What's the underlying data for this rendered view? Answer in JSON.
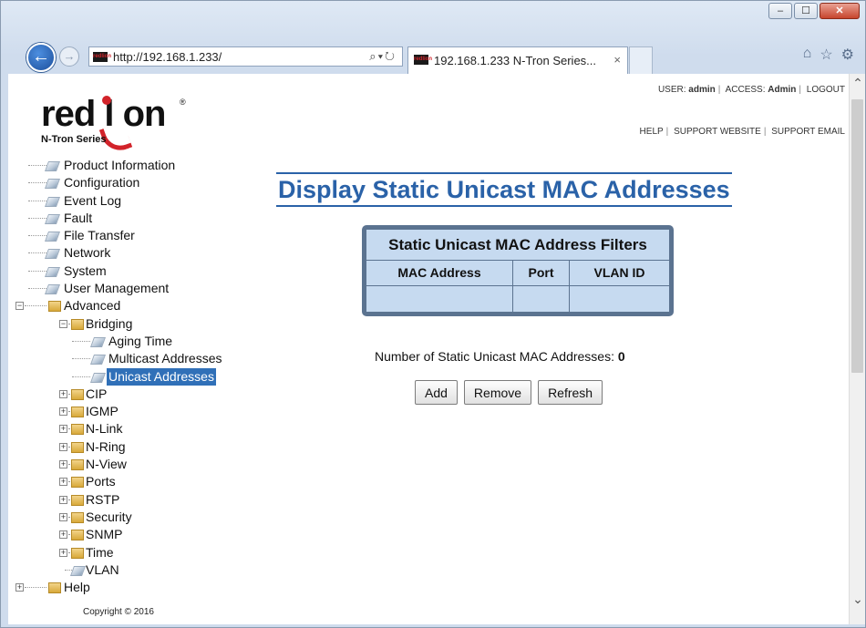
{
  "browser": {
    "url": "http://192.168.1.233/",
    "tab_title": "192.168.1.233 N-Tron Series...",
    "favicon_text": "redlion",
    "tab_close": "×",
    "window_buttons": {
      "minimize": "–",
      "maximize": "☐",
      "close": "✕"
    },
    "icons": [
      "back-arrow-icon",
      "forward-arrow-icon",
      "search-icon",
      "refresh-icon",
      "home-icon",
      "star-icon",
      "gear-icon"
    ]
  },
  "header": {
    "logo_text": "red lion",
    "logo_sub": "N-Tron Series",
    "user_label": "USER:",
    "user_value": "admin",
    "access_label": "ACCESS:",
    "access_value": "Admin",
    "logout": "LOGOUT",
    "help": "HELP",
    "support_website": "SUPPORT WEBSITE",
    "support_email": "SUPPORT EMAIL"
  },
  "nav": {
    "items": [
      {
        "label": "Product Information"
      },
      {
        "label": "Configuration"
      },
      {
        "label": "Event Log"
      },
      {
        "label": "Fault"
      },
      {
        "label": "File Transfer"
      },
      {
        "label": "Network"
      },
      {
        "label": "System"
      },
      {
        "label": "User Management"
      },
      {
        "label": "Advanced"
      },
      {
        "label": "Bridging"
      },
      {
        "label": "Aging Time"
      },
      {
        "label": "Multicast Addresses"
      },
      {
        "label": "Unicast Addresses"
      },
      {
        "label": "CIP"
      },
      {
        "label": "IGMP"
      },
      {
        "label": "N-Link"
      },
      {
        "label": "N-Ring"
      },
      {
        "label": "N-View"
      },
      {
        "label": "Ports"
      },
      {
        "label": "RSTP"
      },
      {
        "label": "Security"
      },
      {
        "label": "SNMP"
      },
      {
        "label": "Time"
      },
      {
        "label": "VLAN"
      },
      {
        "label": "Help"
      }
    ],
    "selected": "Unicast Addresses"
  },
  "copyright": "Copyright © 2016",
  "main": {
    "title": "Display Static Unicast MAC Addresses",
    "table": {
      "title": "Static Unicast MAC Address Filters",
      "columns": [
        "MAC Address",
        "Port",
        "VLAN ID"
      ]
    },
    "count_label": "Number of Static Unicast MAC Addresses:",
    "count_value": "0",
    "buttons": {
      "add": "Add",
      "remove": "Remove",
      "refresh": "Refresh"
    }
  }
}
